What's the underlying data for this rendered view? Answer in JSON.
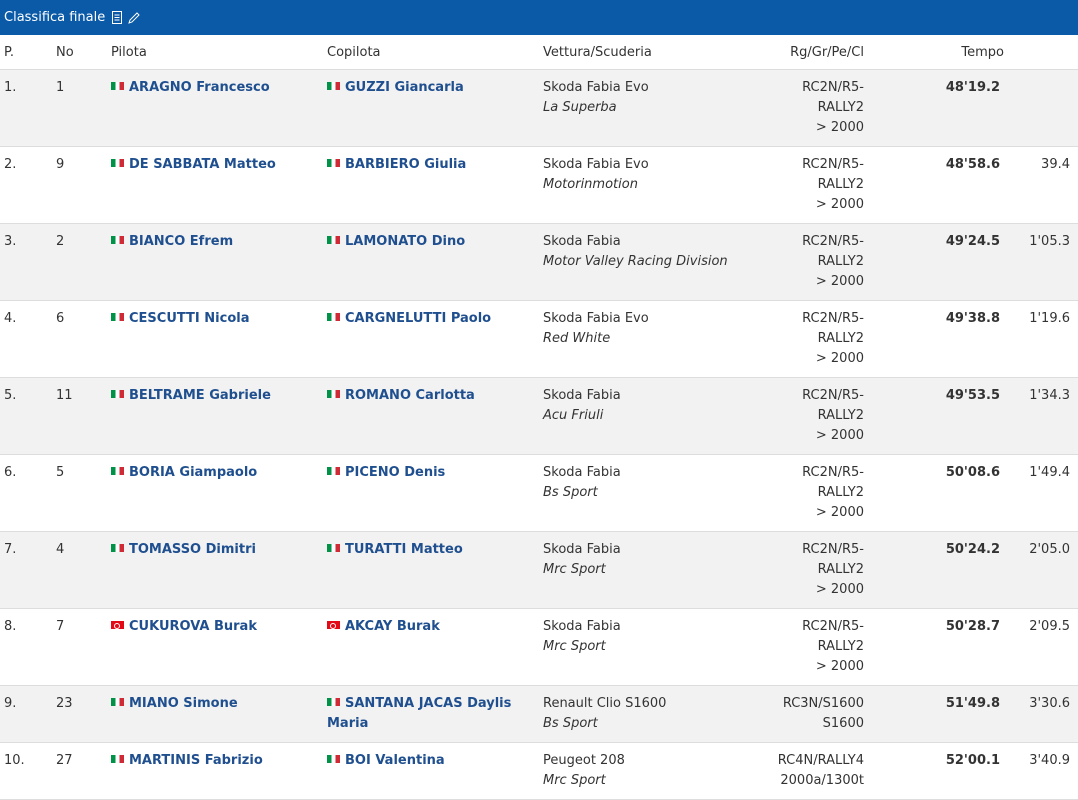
{
  "header": {
    "title": "Classifica finale"
  },
  "columns": {
    "pos": "P.",
    "no": "No",
    "driver": "Pilota",
    "codriver": "Copilota",
    "car": "Vettura/Scuderia",
    "cls": "Rg/Gr/Pe/Cl",
    "time": "Tempo"
  },
  "rows": [
    {
      "pos": "1.",
      "no": "1",
      "driver": "ARAGNO Francesco",
      "driver_flag": "it",
      "codriver": "GUZZI Giancarla",
      "codriver_flag": "it",
      "car": "Skoda Fabia Evo",
      "team": "La Superba",
      "cls1": "RC2N/R5-",
      "cls2": "RALLY2",
      "cls3": "> 2000",
      "time": "48'19.2",
      "gap": ""
    },
    {
      "pos": "2.",
      "no": "9",
      "driver": "DE SABBATA Matteo",
      "driver_flag": "it",
      "codriver": "BARBIERO Giulia",
      "codriver_flag": "it",
      "car": "Skoda Fabia Evo",
      "team": "Motorinmotion",
      "cls1": "RC2N/R5-",
      "cls2": "RALLY2",
      "cls3": "> 2000",
      "time": "48'58.6",
      "gap": "39.4"
    },
    {
      "pos": "3.",
      "no": "2",
      "driver": "BIANCO Efrem",
      "driver_flag": "it",
      "codriver": "LAMONATO Dino",
      "codriver_flag": "it",
      "car": "Skoda Fabia",
      "team": "Motor Valley Racing Division",
      "cls1": "RC2N/R5-",
      "cls2": "RALLY2",
      "cls3": "> 2000",
      "time": "49'24.5",
      "gap": "1'05.3"
    },
    {
      "pos": "4.",
      "no": "6",
      "driver": "CESCUTTI Nicola",
      "driver_flag": "it",
      "codriver": "CARGNELUTTI Paolo",
      "codriver_flag": "it",
      "car": "Skoda Fabia Evo",
      "team": "Red White",
      "cls1": "RC2N/R5-",
      "cls2": "RALLY2",
      "cls3": "> 2000",
      "time": "49'38.8",
      "gap": "1'19.6"
    },
    {
      "pos": "5.",
      "no": "11",
      "driver": "BELTRAME Gabriele",
      "driver_flag": "it",
      "codriver": "ROMANO Carlotta",
      "codriver_flag": "it",
      "car": "Skoda Fabia",
      "team": "Acu Friuli",
      "cls1": "RC2N/R5-",
      "cls2": "RALLY2",
      "cls3": "> 2000",
      "time": "49'53.5",
      "gap": "1'34.3"
    },
    {
      "pos": "6.",
      "no": "5",
      "driver": "BORIA Giampaolo",
      "driver_flag": "it",
      "codriver": "PICENO Denis",
      "codriver_flag": "it",
      "car": "Skoda Fabia",
      "team": "Bs Sport",
      "cls1": "RC2N/R5-",
      "cls2": "RALLY2",
      "cls3": "> 2000",
      "time": "50'08.6",
      "gap": "1'49.4"
    },
    {
      "pos": "7.",
      "no": "4",
      "driver": "TOMASSO Dimitri",
      "driver_flag": "it",
      "codriver": "TURATTI Matteo",
      "codriver_flag": "it",
      "car": "Skoda Fabia",
      "team": "Mrc Sport",
      "cls1": "RC2N/R5-",
      "cls2": "RALLY2",
      "cls3": "> 2000",
      "time": "50'24.2",
      "gap": "2'05.0"
    },
    {
      "pos": "8.",
      "no": "7",
      "driver": "CUKUROVA Burak",
      "driver_flag": "tr",
      "codriver": "AKCAY Burak",
      "codriver_flag": "tr",
      "car": "Skoda Fabia",
      "team": "Mrc Sport",
      "cls1": "RC2N/R5-",
      "cls2": "RALLY2",
      "cls3": "> 2000",
      "time": "50'28.7",
      "gap": "2'09.5"
    },
    {
      "pos": "9.",
      "no": "23",
      "driver": "MIANO Simone",
      "driver_flag": "it",
      "codriver": "SANTANA JACAS Daylis Maria",
      "codriver_flag": "it",
      "car": "Renault Clio S1600",
      "team": "Bs Sport",
      "cls1": "RC3N/S1600",
      "cls2": "S1600",
      "cls3": "",
      "time": "51'49.8",
      "gap": "3'30.6"
    },
    {
      "pos": "10.",
      "no": "27",
      "driver": "MARTINIS Fabrizio",
      "driver_flag": "it",
      "codriver": "BOI Valentina",
      "codriver_flag": "it",
      "car": "Peugeot 208",
      "team": "Mrc Sport",
      "cls1": "RC4N/RALLY4",
      "cls2": "2000a/1300t",
      "cls3": "",
      "time": "52'00.1",
      "gap": "3'40.9"
    }
  ]
}
